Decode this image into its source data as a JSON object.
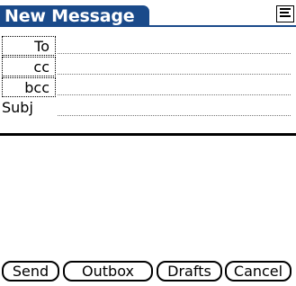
{
  "title": "New Message",
  "menu_icon": "menu-icon",
  "fields": [
    {
      "label": "To",
      "value": ""
    },
    {
      "label": "cc",
      "value": ""
    },
    {
      "label": "bcc",
      "value": ""
    },
    {
      "label": "Subj",
      "value": ""
    }
  ],
  "body_text": "",
  "buttons": {
    "send": "Send",
    "outbox": "Outbox",
    "drafts": "Drafts",
    "cancel": "Cancel"
  },
  "colors": {
    "title_bar": "#1a4a8a",
    "background": "#ffffff",
    "text": "#000000"
  }
}
